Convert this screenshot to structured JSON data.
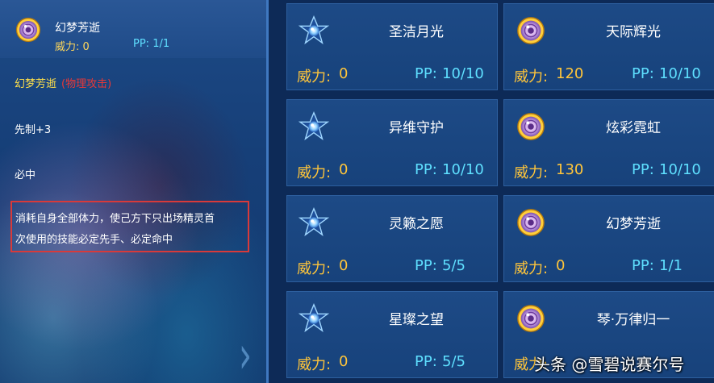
{
  "selected_skill": {
    "name": "幻梦芳逝",
    "power_label": "威力: 0",
    "pp_label": "PP: 1/1",
    "detail_name": "幻梦芳逝",
    "detail_category": "(物理攻击)",
    "priority": "先制+3",
    "accuracy": "必中",
    "description_line1": "消耗自身全部体力，使己方下只出场精灵首",
    "description_line2": "次使用的技能必定先手、必定命中"
  },
  "skills": [
    {
      "name": "圣洁月光",
      "power_label": "威力:",
      "power": "0",
      "pp_label": "PP:",
      "pp": "10/10",
      "icon": "star-icon"
    },
    {
      "name": "天际辉光",
      "power_label": "威力:",
      "power": "120",
      "pp_label": "PP:",
      "pp": "10/10",
      "icon": "orb-icon"
    },
    {
      "name": "异维守护",
      "power_label": "威力:",
      "power": "0",
      "pp_label": "PP:",
      "pp": "10/10",
      "icon": "star-icon"
    },
    {
      "name": "炫彩霓虹",
      "power_label": "威力:",
      "power": "130",
      "pp_label": "PP:",
      "pp": "10/10",
      "icon": "orb-icon"
    },
    {
      "name": "灵籁之愿",
      "power_label": "威力:",
      "power": "0",
      "pp_label": "PP:",
      "pp": "5/5",
      "icon": "star-icon"
    },
    {
      "name": "幻梦芳逝",
      "power_label": "威力:",
      "power": "0",
      "pp_label": "PP:",
      "pp": "1/1",
      "icon": "orb-icon"
    },
    {
      "name": "星璨之望",
      "power_label": "威力:",
      "power": "0",
      "pp_label": "PP:",
      "pp": "5/5",
      "icon": "star-icon"
    },
    {
      "name": "琴·万律归一",
      "power_label": "威力:",
      "power": "",
      "pp_label": "",
      "pp": "",
      "icon": "orb-icon"
    }
  ],
  "watermark": "头条 @雪碧说赛尔号",
  "colors": {
    "power": "#ffc53a",
    "pp": "#5fe0ff",
    "category": "#e83838",
    "highlight_box": "#d83a3a"
  }
}
